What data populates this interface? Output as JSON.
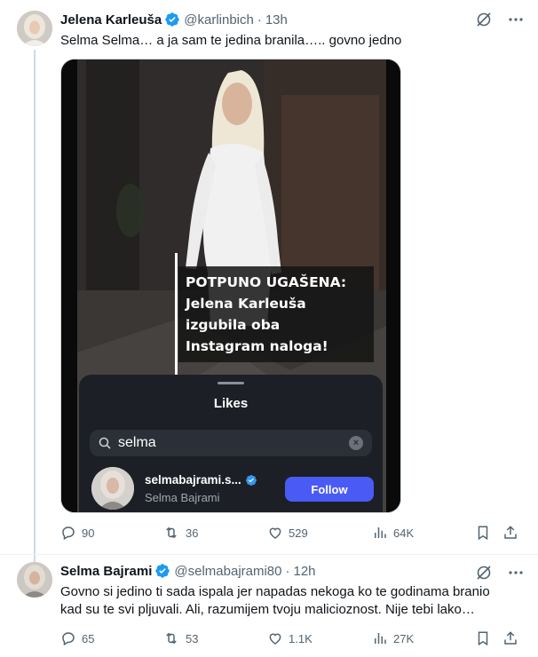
{
  "tweets": [
    {
      "author_name": "Jelena Karleuša",
      "handle": "@karlinbich",
      "time": "13h",
      "text": "Selma Selma… a ja sam te jedina branila….. govno jedno",
      "media": {
        "caption_lines": [
          "POTPUNO UGAŠENA:",
          "Jelena Karleuša",
          "izgubila oba",
          "Instagram naloga!"
        ],
        "likes_sheet": {
          "title": "Likes",
          "search_value": "selma",
          "result_username": "selmabajrami.s...",
          "result_name": "Selma Bajrami",
          "follow_label": "Follow"
        }
      },
      "stats": {
        "replies": "90",
        "reposts": "36",
        "likes": "529",
        "views": "64K"
      }
    },
    {
      "author_name": "Selma Bajrami",
      "handle": "@selmabajrami80",
      "time": "12h",
      "text_line1": "Govno si jedino ti sada ispala jer napadas nekoga ko te godinama branio",
      "text_line2": "kad su te svi pljuvali. Ali, razumijem tvoju malicioznost. Nije tebi lako…",
      "stats": {
        "replies": "65",
        "reposts": "53",
        "likes": "1.1K",
        "views": "27K"
      }
    }
  ],
  "icons": {
    "verified": "verified-badge-icon",
    "grok": "grok-icon",
    "more": "more-icon",
    "reply": "reply-icon",
    "repost": "repost-icon",
    "like": "heart-icon",
    "views": "views-icon",
    "bookmark": "bookmark-icon",
    "share": "share-icon",
    "search": "search-icon",
    "clear": "clear-icon"
  },
  "colors": {
    "verified": "#1d9bf0",
    "secondary_text": "#536471",
    "follow_button": "#4a5bf5"
  }
}
